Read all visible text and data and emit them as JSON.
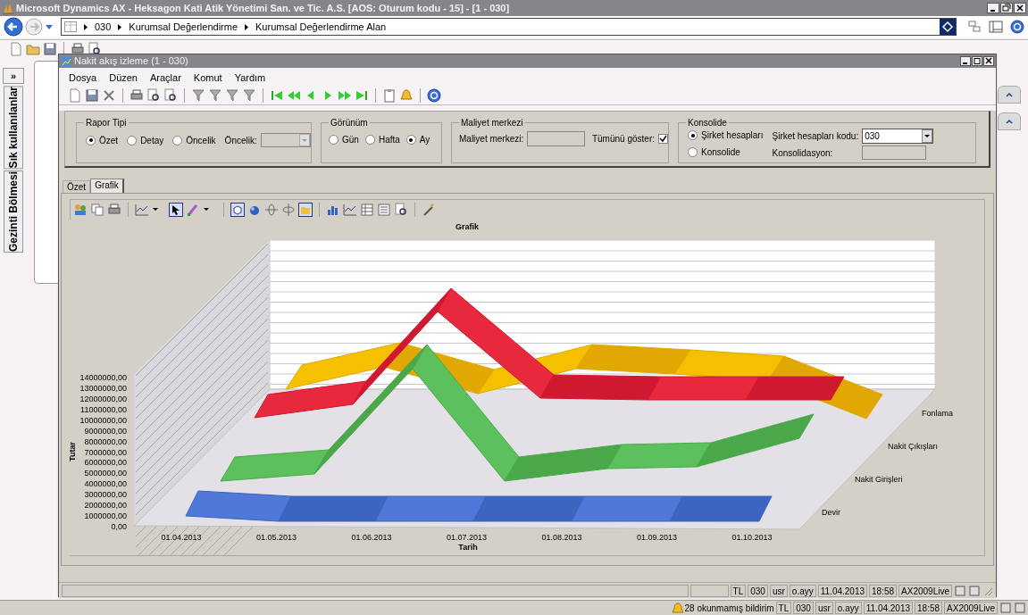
{
  "window": {
    "title": "Microsoft Dynamics AX - Heksagon Kati Atik Yönetimi San. ve Tic. A.S. [AOS: Oturum kodu - 15] - [1 - 030]"
  },
  "address_bar": {
    "crumbs": [
      "030",
      "Kurumsal Değerlendirme",
      "Kurumsal Değerlendirme Alan"
    ]
  },
  "nav_pane": {
    "expand": "»",
    "tabs": [
      "Sık kullanılanlar",
      "Gezinti Bölmesi"
    ]
  },
  "form": {
    "title": "Nakit akış izleme (1 - 030)",
    "menu": [
      "Dosya",
      "Düzen",
      "Araçlar",
      "Komut",
      "Yardım"
    ],
    "report_type": {
      "title": "Rapor Tipi",
      "options": [
        {
          "label": "Özet",
          "selected": true
        },
        {
          "label": "Detay",
          "selected": false
        },
        {
          "label": "Öncelik",
          "selected": false
        }
      ],
      "priority_label": "Öncelik:"
    },
    "view": {
      "title": "Görünüm",
      "options": [
        {
          "label": "Gün",
          "selected": false
        },
        {
          "label": "Hafta",
          "selected": false
        },
        {
          "label": "Ay",
          "selected": true
        }
      ]
    },
    "cost_center": {
      "title": "Maliyet merkezi",
      "field_label": "Maliyet merkezi:",
      "show_all_label": "Tümünü göster:",
      "show_all_checked": true
    },
    "consolidation": {
      "title": "Konsolide",
      "options": [
        {
          "label": "Şirket hesapları",
          "selected": true
        },
        {
          "label": "Konsolide",
          "selected": false
        }
      ],
      "code_label": "Şirket hesapları kodu:",
      "code_value": "030",
      "consolidation_label": "Konsolidasyon:"
    },
    "tabs": [
      {
        "label": "Özet",
        "selected": false
      },
      {
        "label": "Grafik",
        "selected": true
      }
    ],
    "chart": {
      "title": "Grafik",
      "ylabel": "Tutar",
      "xlabel": "Tarih",
      "yticks": [
        "14000000,00",
        "13000000,00",
        "12000000,00",
        "11000000,00",
        "10000000,00",
        "9000000,00",
        "8000000,00",
        "7000000,00",
        "6000000,00",
        "5000000,00",
        "4000000,00",
        "3000000,00",
        "2000000,00",
        "1000000,00",
        "0,00"
      ],
      "xticks": [
        "01.04.2013",
        "01.05.2013",
        "01.06.2013",
        "01.07.2013",
        "01.08.2013",
        "01.09.2013",
        "01.10.2013"
      ],
      "series_labels": [
        "Fonlama",
        "Nakit Çıkışları",
        "Nakit Girişleri",
        "Devir"
      ]
    },
    "status_bar": [
      "TL",
      "030",
      "usr",
      "o.ayy",
      "11.04.2013",
      "18:58",
      "AX2009Live"
    ]
  },
  "status_bar": {
    "notice": "28 okunmamış bildirim",
    "cells": [
      "TL",
      "030",
      "usr",
      "o.ayy",
      "11.04.2013",
      "18:58",
      "AX2009Live"
    ]
  }
}
